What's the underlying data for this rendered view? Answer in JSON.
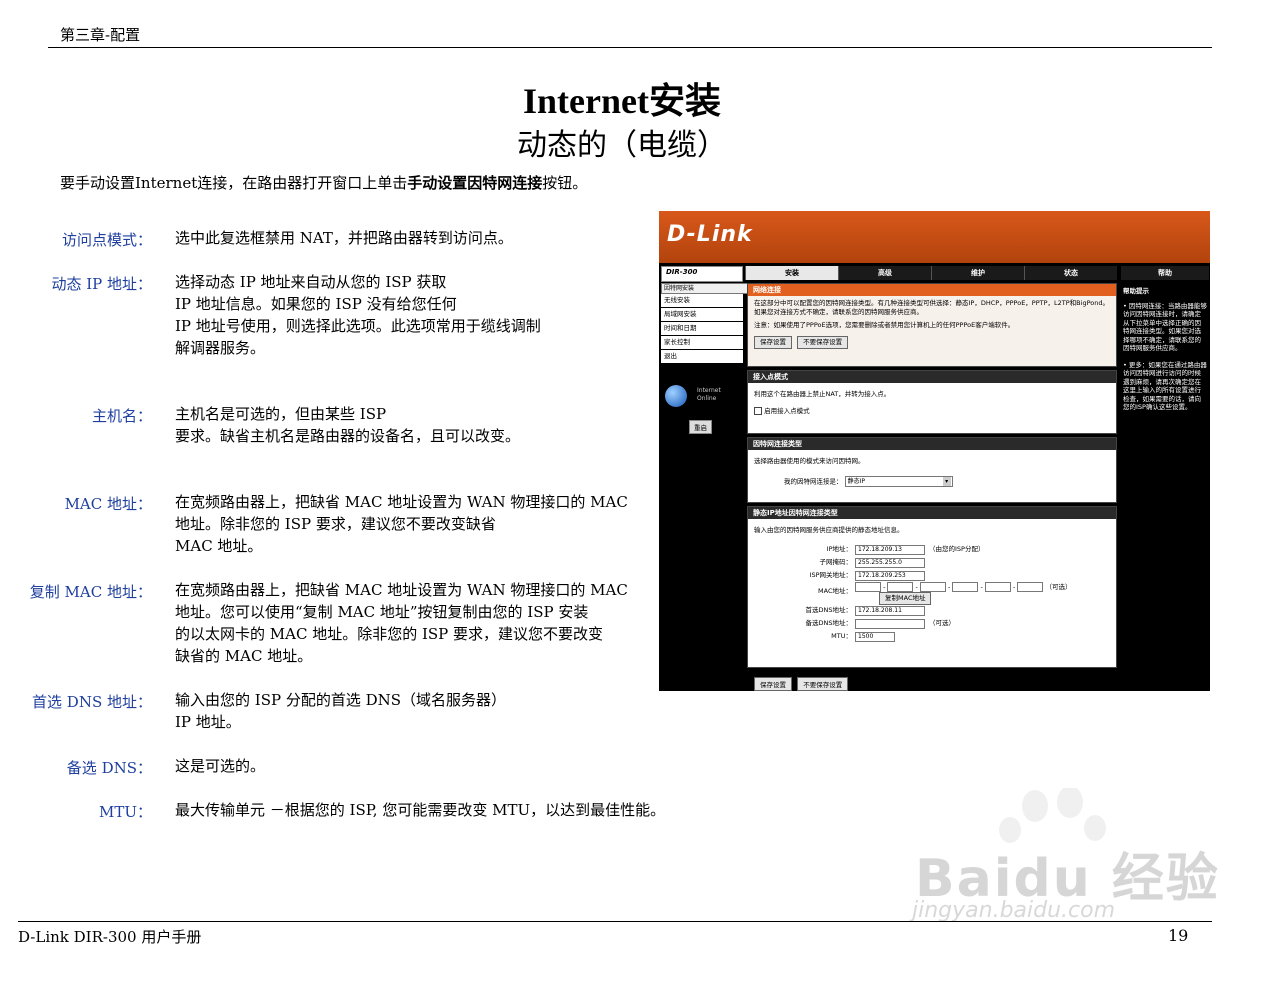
{
  "header": {
    "chapter": "第三章-配置"
  },
  "title": "Internet安装",
  "subtitle": "动态的（电缆）",
  "intro": {
    "pre": "要手动设置Internet连接，在路由器打开窗口上单击",
    "bold": "手动设置因特网连接",
    "post": "按钮。"
  },
  "items": [
    {
      "term": "访问点模式：",
      "desc": "选中此复选框禁用 NAT，并把路由器转到访问点。"
    },
    {
      "term": "动态 IP 地址：",
      "desc": "选择动态 IP 地址来自动从您的 ISP 获取\nIP 地址信息。如果您的 ISP 没有给您任何\nIP 地址号使用，则选择此选项。此选项常用于缆线调制\n解调器服务。"
    },
    {
      "term": "主机名：",
      "desc": "主机名是可选的，但由某些 ISP\n要求。缺省主机名是路由器的设备名，且可以改变。"
    },
    {
      "term": "MAC 地址：",
      "desc": "在宽频路由器上，把缺省 MAC 地址设置为 WAN 物理接口的 MAC\n地址。除非您的 ISP 要求，建议您不要改变缺省\nMAC 地址。"
    },
    {
      "term": "复制 MAC 地址：",
      "desc": "在宽频路由器上，把缺省 MAC 地址设置为 WAN 物理接口的 MAC\n地址。您可以使用“复制 MAC 地址”按钮复制由您的 ISP 安装\n的以太网卡的 MAC 地址。除非您的 ISP 要求，建议您不要改变\n缺省的 MAC 地址。"
    },
    {
      "term": "首选 DNS 地址：",
      "desc": "输入由您的 ISP 分配的首选 DNS（域名服务器）\nIP 地址。"
    },
    {
      "term": "备选 DNS：",
      "desc": "这是可选的。"
    },
    {
      "term": "MTU：",
      "desc": "最大传输单元 －根据您的 ISP, 您可能需要改变 MTU，以达到最佳性能。"
    }
  ],
  "footer": {
    "left": "D-Link DIR-300 用户手册",
    "page": "19"
  },
  "watermark": {
    "text": "Baidu 经验",
    "url": "jingyan.baidu.com"
  },
  "router": {
    "brand": "D-Link",
    "model": "DIR-300",
    "tabs": [
      "安装",
      "高级",
      "维护",
      "状态"
    ],
    "help_tab": "帮助",
    "nav": [
      "因特网安装",
      "无线安装",
      "局域网安装",
      "时间和日期",
      "家长控制",
      "退出"
    ],
    "ie_text": "Internet\nOnline",
    "reboot": "重启",
    "panel1": {
      "title": "网络连接",
      "text": "在这部分中可以配置您的因特网连接类型。有几种连接类型可供选择：静态IP，DHCP，PPPoE，PPTP，L2TP和BigPond。如果您对连接方式不确定，请联系您的因特网服务供应商。",
      "note": "注意：如果使用了PPPoE选项，您需要删除或者禁用您计算机上的任何PPPoE客户端软件。",
      "save": "保存设置",
      "nosave": "不要保存设置"
    },
    "panel2": {
      "title": "接入点模式",
      "text": "利用这个在路由器上禁止NAT，并转为接入点。",
      "checkbox": "启用接入点模式"
    },
    "panel3": {
      "title": "因特网连接类型",
      "text": "选择路由器使用的模式来访问因特网。",
      "label": "我的因特网连接是：",
      "value": "静态IP"
    },
    "panel4": {
      "title": "静态IP地址因特网连接类型",
      "text": "输入由您的因特网服务供应商提供的静态地址信息。",
      "ip_label": "IP地址：",
      "ip_value": "172.18.209.13",
      "ip_note": "（由您的ISP分配）",
      "mask_label": "子网掩码：",
      "mask_value": "255.255.255.0",
      "gw_label": "ISP网关地址：",
      "gw_value": "172.18.209.253",
      "mac_label": "MAC地址：",
      "mac_note": "（可选）",
      "clone": "复制MAC地址",
      "dns1_label": "首选DNS地址：",
      "dns1_value": "172.18.208.11",
      "dns2_label": "备选DNS地址：",
      "dns2_note": "（可选）",
      "mtu_label": "MTU：",
      "mtu_value": "1500"
    },
    "help": {
      "title": "帮助提示",
      "p1": "• 因特网连接：当路由器能够访问因特网连接时，请确定从下拉菜单中选择正确的因特网连接类型。如果您对选择哪项不确定，请联系您的因特网服务供应商。",
      "p2": "• 更多：如果您在通过路由器访问因特网进行访问的时候遇到麻烦，请再次确定您在这里上输入的所有设置进行检查，如果需要的话，请向您的ISP确认这些设置。"
    },
    "bottom_save": "保存设置",
    "bottom_nosave": "不要保存设置"
  }
}
